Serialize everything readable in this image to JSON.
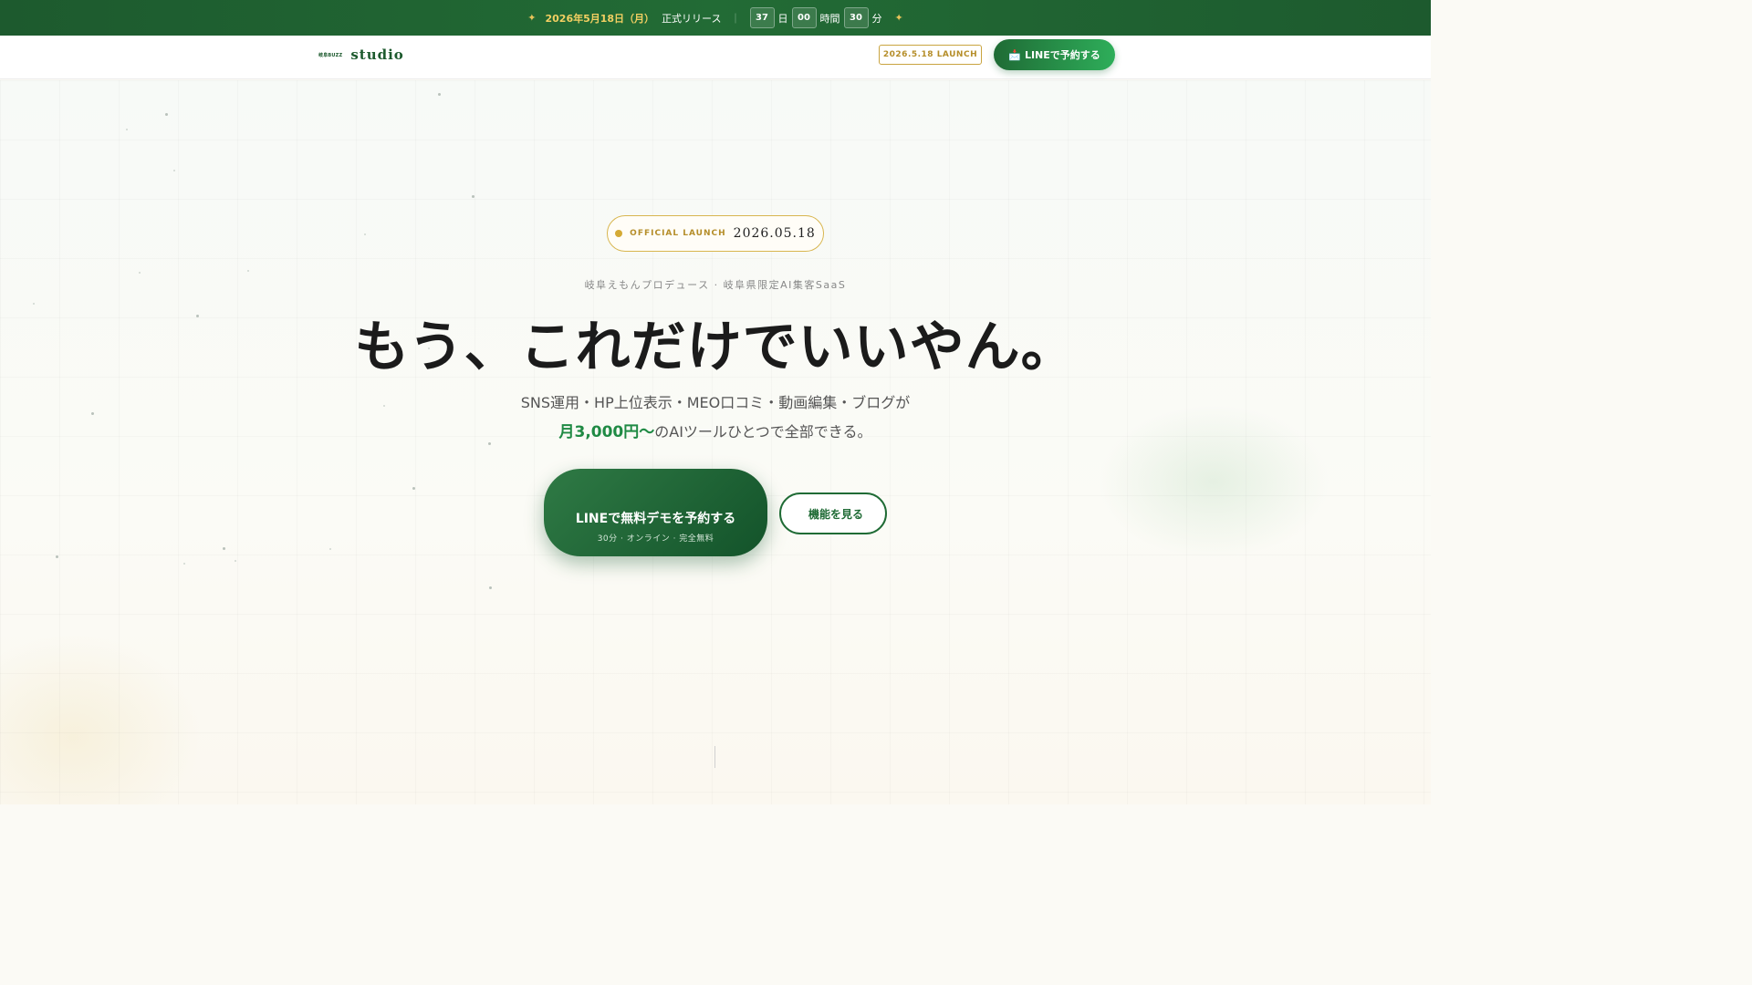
{
  "announcement": {
    "spark_left": "✦",
    "spark_right": "✦",
    "date": "2026年5月18日（月）",
    "release": "正式リリース",
    "separator": "｜",
    "countdown": [
      {
        "value": "37",
        "unit": "日"
      },
      {
        "value": "00",
        "unit": "時間"
      },
      {
        "value": "30",
        "unit": "分"
      }
    ]
  },
  "header": {
    "logo_mark": "岐阜BUZZ",
    "logo_text": "studio",
    "launch_tag": "2026.5.18 LAUNCH",
    "cta_icon": "📩",
    "cta_label": "LINEで予約する"
  },
  "hero": {
    "badge_label": "OFFICIAL LAUNCH",
    "badge_value": "2026.05.18",
    "subtitle": "岐阜えもんプロデュース · 岐阜県限定AI集客SaaS",
    "headline": "もう、これだけでいいやん。",
    "desc_line1": "SNS運用・HP上位表示・MEO口コミ・動画編集・ブログが",
    "desc_price": "月3,000円〜",
    "desc_line2_rest": "のAIツールひとつで全部できる。",
    "cta_main_icon": "",
    "cta_main_label": "LINEで無料デモを予約する",
    "cta_main_sub": "30分 · オンライン · 完全無料",
    "cta_sub_icon": "",
    "cta_sub_label": "機能を見る",
    "scroll_icon": ""
  },
  "colors": {
    "brand_green": "#1f6b35",
    "accent_gold": "#d4aa35",
    "price_green": "#1f8a44"
  }
}
